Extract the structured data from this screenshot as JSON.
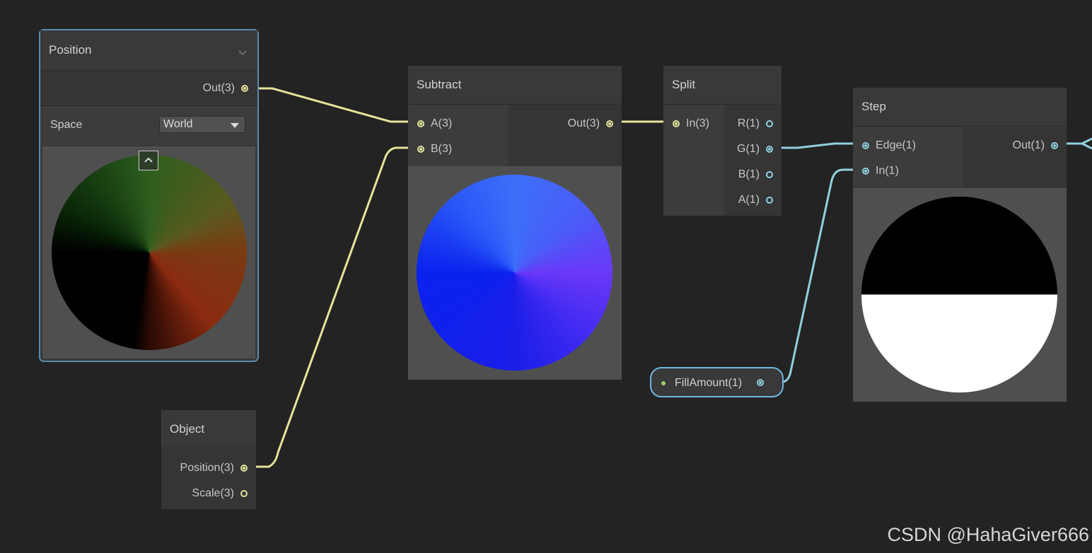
{
  "colors": {
    "background": "#232323",
    "node": "#393939",
    "wire_vector3": "#e4e39a",
    "wire_vector1": "#90d0de",
    "selection": "#5a8bb0"
  },
  "position_node": {
    "title": "Position",
    "collapse_icon": "chevron-down-icon",
    "out_port": "Out(3)",
    "space_label": "Space",
    "space_value": "World",
    "preview_toggle_icon": "chevron-up-icon"
  },
  "object_node": {
    "title": "Object",
    "ports": [
      "Position(3)",
      "Scale(3)"
    ]
  },
  "subtract_node": {
    "title": "Subtract",
    "inputs": [
      "A(3)",
      "B(3)"
    ],
    "output": "Out(3)"
  },
  "split_node": {
    "title": "Split",
    "input": "In(3)",
    "outputs": [
      "R(1)",
      "G(1)",
      "B(1)",
      "A(1)"
    ]
  },
  "fill_property": {
    "label": "FillAmount(1)"
  },
  "step_node": {
    "title": "Step",
    "inputs": [
      "Edge(1)",
      "In(1)"
    ],
    "output": "Out(1)"
  },
  "watermark": "CSDN @HahaGiver666"
}
